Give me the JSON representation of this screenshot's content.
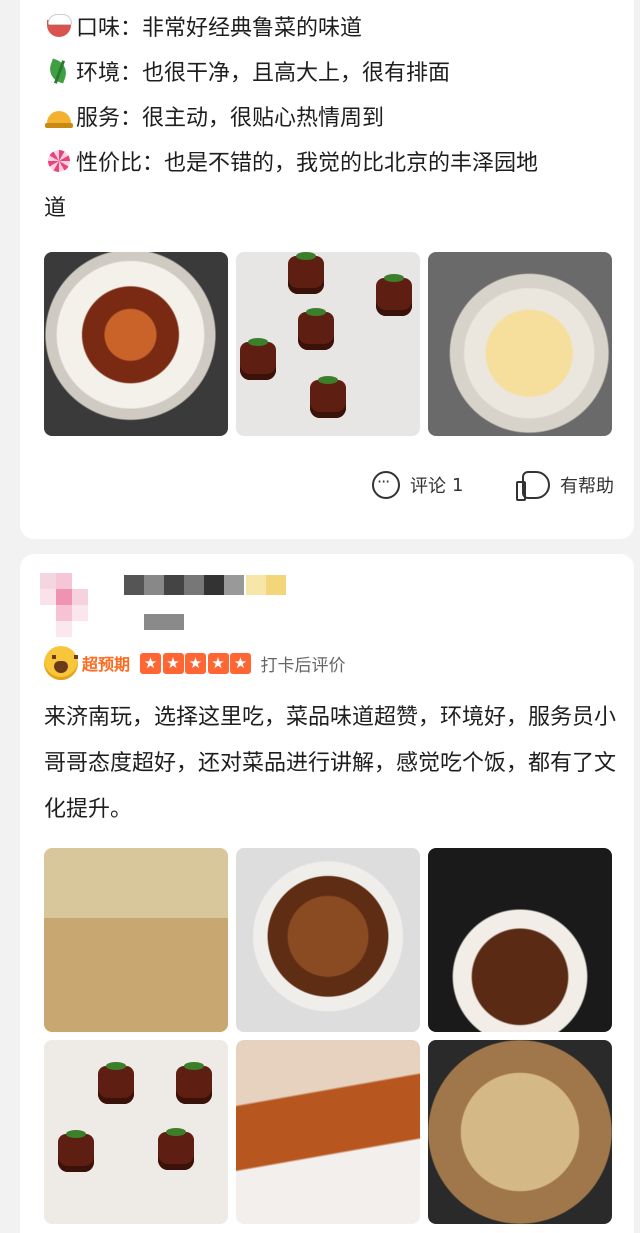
{
  "review1": {
    "lines": [
      {
        "icon": "rice-bowl-icon",
        "text": "口味：非常好经典鲁菜的味道"
      },
      {
        "icon": "herb-icon",
        "text": "环境：也很干净，且高大上，很有排面"
      },
      {
        "icon": "bellhop-bell-icon",
        "text": "服务：很主动，很贴心热情周到"
      },
      {
        "icon": "lollipop-icon",
        "text": "性价比：也是不错的，我觉的比北京的丰泽园地"
      },
      {
        "icon": "",
        "text": "道"
      }
    ],
    "comment_label": "评论",
    "comment_count": "1",
    "helpful_label": "有帮助"
  },
  "review2": {
    "expectation_badge": "超预期",
    "star_count": 5,
    "checkin_label": "打卡后评价",
    "text": "来济南玩，选择这里吃，菜品味道超赞，环境好，服务员小哥哥态度超好，还对菜品进行讲解，感觉吃个饭，都有了文化提升。"
  },
  "colors": {
    "accent": "#ff6633",
    "badge_text": "#ff6a1f",
    "page_bg": "#f2f2f2",
    "card_bg": "#ffffff"
  }
}
